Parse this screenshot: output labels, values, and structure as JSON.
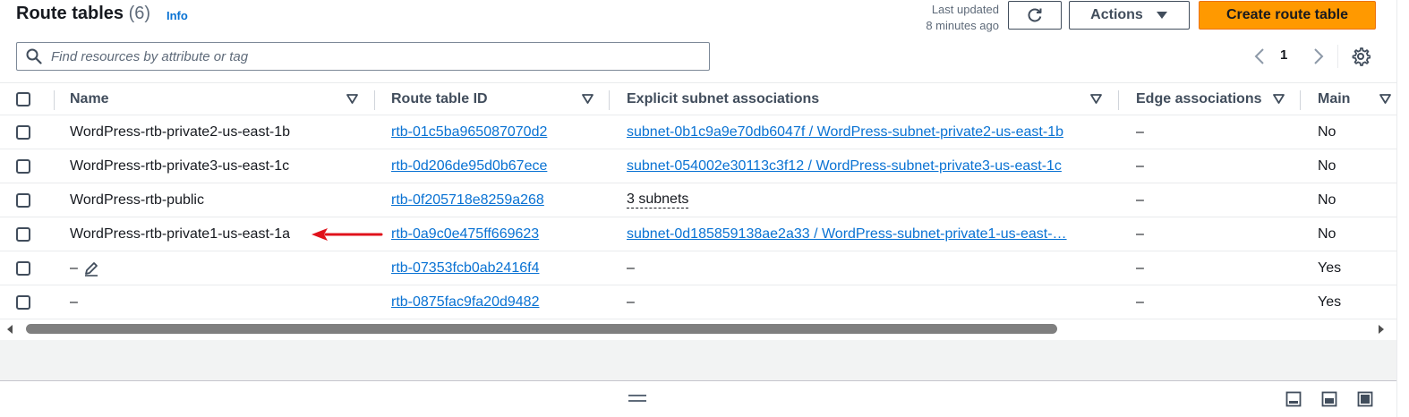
{
  "header": {
    "title": "Route tables",
    "count": "(6)",
    "info_label": "Info",
    "last_updated_line1": "Last updated",
    "last_updated_line2": "8 minutes ago",
    "actions_label": "Actions",
    "create_label": "Create route table"
  },
  "search": {
    "placeholder": "Find resources by attribute or tag"
  },
  "pagination": {
    "current_page": "1"
  },
  "columns": {
    "name": "Name",
    "route_table_id": "Route table ID",
    "explicit_subnet": "Explicit subnet associations",
    "edge": "Edge associations",
    "main": "Main"
  },
  "rows": [
    {
      "name": "WordPress-rtb-private2-us-east-1b",
      "id": "rtb-01c5ba965087070d2",
      "subnet": "subnet-0b1c9a9e70db6047f / WordPress-subnet-private2-us-east-1b",
      "edge": "–",
      "main": "No"
    },
    {
      "name": "WordPress-rtb-private3-us-east-1c",
      "id": "rtb-0d206de95d0b67ece",
      "subnet": "subnet-054002e30113c3f12 / WordPress-subnet-private3-us-east-1c",
      "edge": "–",
      "main": "No"
    },
    {
      "name": "WordPress-rtb-public",
      "id": "rtb-0f205718e8259a268",
      "subnet": "3 subnets",
      "edge": "–",
      "main": "No"
    },
    {
      "name": "WordPress-rtb-private1-us-east-1a",
      "id": "rtb-0a9c0e475ff669623",
      "subnet": "subnet-0d185859138ae2a33 / WordPress-subnet-private1-us-east-…",
      "edge": "–",
      "main": "No"
    },
    {
      "name": "–",
      "id": "rtb-07353fcb0ab2416f4",
      "subnet": "–",
      "edge": "–",
      "main": "Yes"
    },
    {
      "name": "–",
      "id": "rtb-0875fac9fa20d9482",
      "subnet": "–",
      "edge": "–",
      "main": "Yes"
    }
  ],
  "icons": {
    "refresh": "refresh-icon",
    "caret": "caret-down-icon",
    "search": "search-icon",
    "settings": "gear-icon",
    "edit": "pencil-icon",
    "annotation": "red-arrow-icon"
  },
  "colors": {
    "primary_button": "#ff9900",
    "link": "#0972d3",
    "annotation_arrow": "#e0121b"
  }
}
